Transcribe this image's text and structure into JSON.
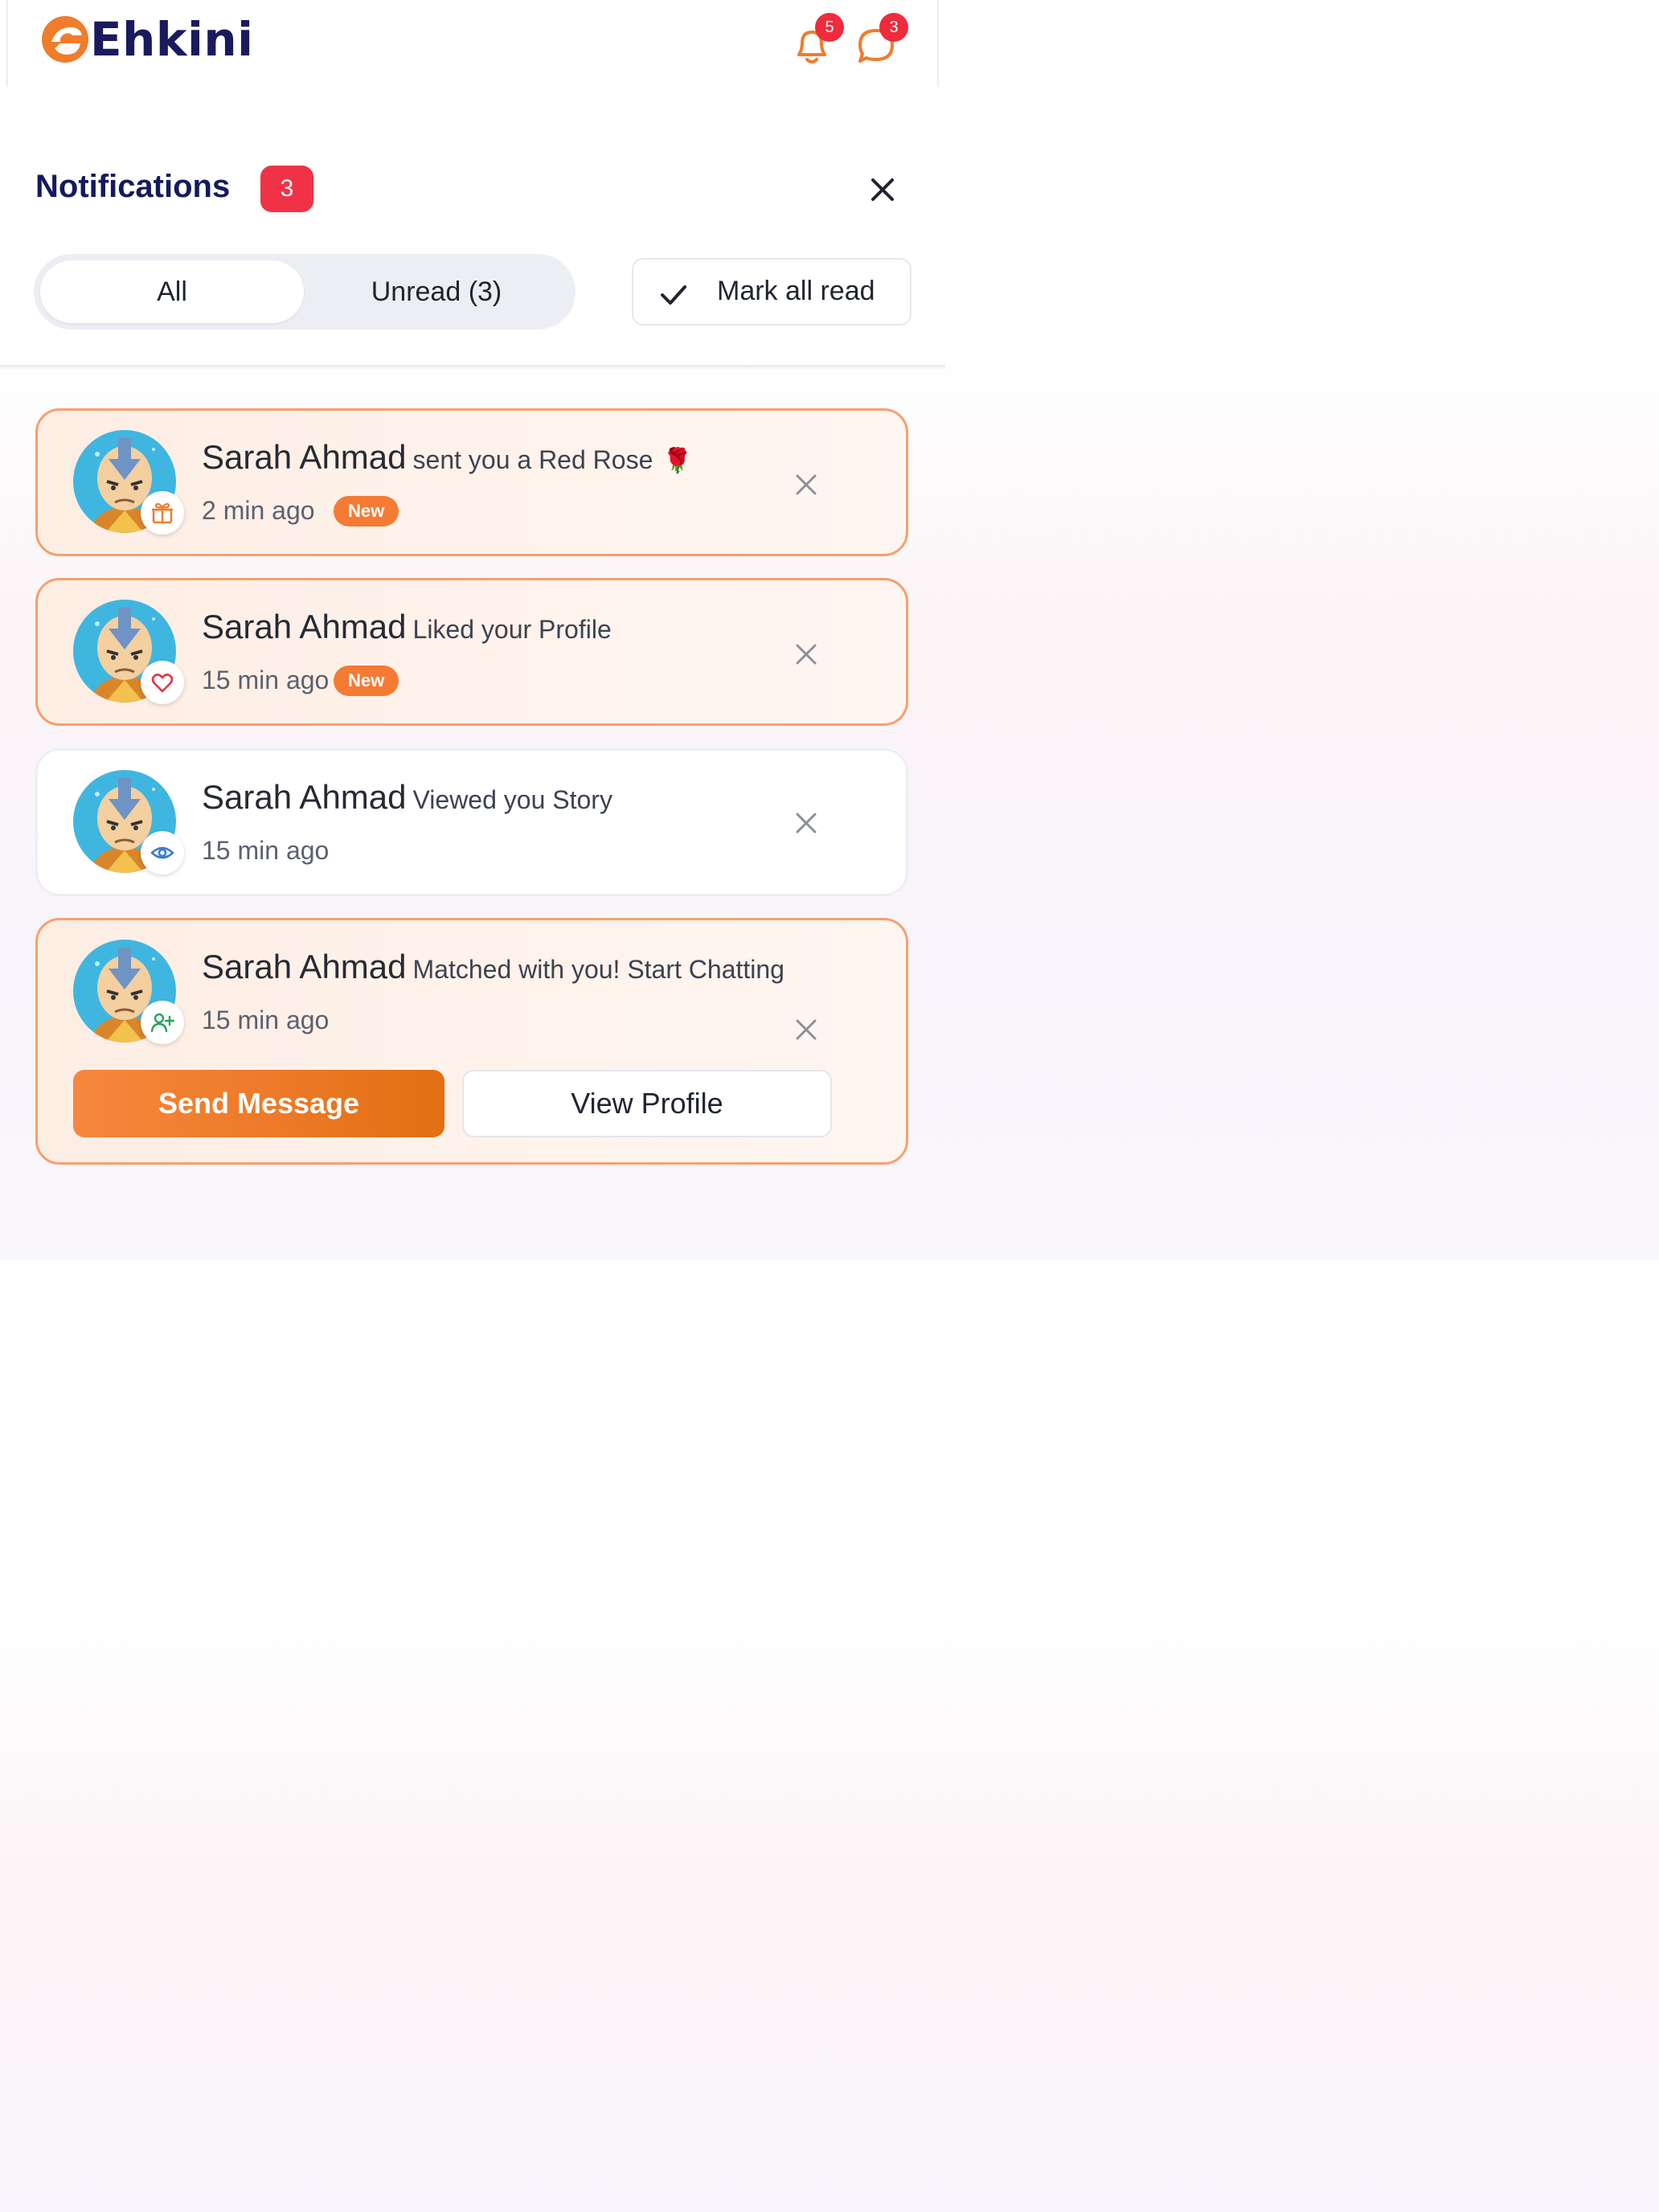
{
  "header": {
    "brand_name": "Ehkini",
    "notifications_count": "5",
    "messages_count": "3",
    "brand_color": "#f07c2c"
  },
  "panel": {
    "title": "Notifications",
    "unread_badge": "3",
    "tabs": [
      {
        "label": "All",
        "selected": true
      },
      {
        "label": "Unread (3)",
        "selected": false
      }
    ],
    "mark_all_read_label": "Mark all read"
  },
  "notifications": [
    {
      "name": "Sarah Ahmad",
      "action": "sent you a Red Rose",
      "emoji": "🌹",
      "time": "2 min ago",
      "badge": "New",
      "icon": "gift-icon",
      "unread": true
    },
    {
      "name": "Sarah Ahmad",
      "action": "Liked your Profile",
      "emoji": "",
      "time": "15 min ago",
      "badge": "New",
      "icon": "heart-icon",
      "unread": true
    },
    {
      "name": "Sarah Ahmad",
      "action": "Viewed you Story",
      "emoji": "",
      "time": "15 min ago",
      "badge": "",
      "icon": "eye-icon",
      "unread": false
    },
    {
      "name": "Sarah Ahmad",
      "action": "Matched with you! Start Chatting",
      "emoji": "",
      "time": "15 min ago",
      "badge": "",
      "icon": "user-plus-icon",
      "unread": true,
      "actions": {
        "primary": "Send Message",
        "secondary": "View Profile"
      }
    }
  ]
}
